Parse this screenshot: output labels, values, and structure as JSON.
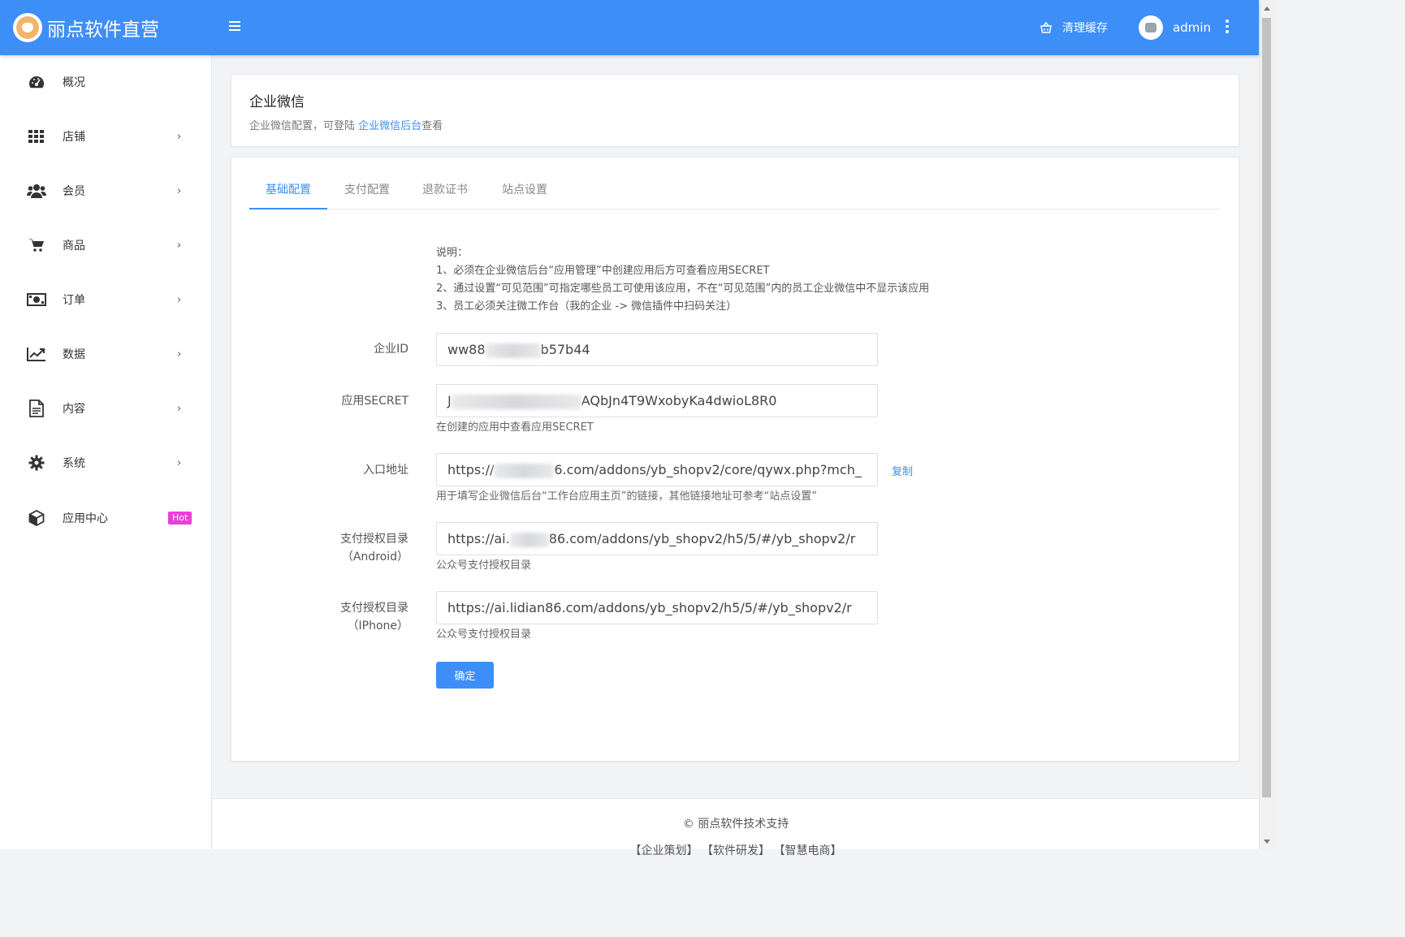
{
  "header": {
    "logo_text": "丽点软件直营",
    "clear_cache": "清理缓存",
    "user": "admin"
  },
  "sidebar": {
    "items": [
      {
        "label": "概况",
        "icon": "dashboard-icon",
        "chevron": false
      },
      {
        "label": "店铺",
        "icon": "grid-icon",
        "chevron": true
      },
      {
        "label": "会员",
        "icon": "users-icon",
        "chevron": true
      },
      {
        "label": "商品",
        "icon": "cart-icon",
        "chevron": true
      },
      {
        "label": "订单",
        "icon": "money-icon",
        "chevron": true
      },
      {
        "label": "数据",
        "icon": "line-chart-icon",
        "chevron": true
      },
      {
        "label": "内容",
        "icon": "document-icon",
        "chevron": true
      },
      {
        "label": "系统",
        "icon": "gear-icon",
        "chevron": true
      },
      {
        "label": "应用中心",
        "icon": "cube-icon",
        "chevron": false,
        "badge": "Hot"
      }
    ],
    "chevron_glyph": "›"
  },
  "page": {
    "title": "企业微信",
    "desc_prefix": "企业微信配置，可登陆 ",
    "desc_link": "企业微信后台",
    "desc_suffix": "查看"
  },
  "tabs": [
    "基础配置",
    "支付配置",
    "退款证书",
    "站点设置"
  ],
  "active_tab": 0,
  "notes": [
    "说明：",
    "1、必须在企业微信后台“应用管理”中创建应用后方可查看应用SECRET",
    "2、通过设置“可见范围”可指定哪些员工可使用该应用，不在“可见范围”内的员工企业微信中不显示该应用",
    "3、员工必须关注微工作台（我的企业 -> 微信插件中扫码关注）"
  ],
  "form": {
    "corp_id": {
      "label": "企业ID",
      "value_start": "ww88",
      "value_end": "b57b44"
    },
    "secret": {
      "label": "应用SECRET",
      "value_start": "J",
      "value_end": "AQbJn4T9WxobyKa4dwioL8R0",
      "help": "在创建的应用中查看应用SECRET"
    },
    "entry": {
      "label": "入口地址",
      "value_start": "https://",
      "value_end": "6.com/addons/yb_shopv2/core/qywx.php?mch_",
      "help": "用于填写企业微信后台“工作台应用主页”的链接，其他链接地址可参考“站点设置”",
      "copy": "复制"
    },
    "pay_android": {
      "label_1": "支付授权目录",
      "label_2": "（Android）",
      "value_start": "https://ai.",
      "value_end": "86.com/addons/yb_shopv2/h5/5/#/yb_shopv2/r",
      "help": "公众号支付授权目录"
    },
    "pay_iphone": {
      "label_1": "支付授权目录",
      "label_2": "（IPhone）",
      "value": "https://ai.lidian86.com/addons/yb_shopv2/h5/5/#/yb_shopv2/r",
      "help": "公众号支付授权目录"
    },
    "submit": "确定"
  },
  "footer": {
    "line1": "© 丽点软件技术支持",
    "line2": "【企业策划】 【软件研发】 【智慧电商】"
  },
  "colors": {
    "primary": "#3e8ef7",
    "hot_badge": "#e83fd6"
  }
}
